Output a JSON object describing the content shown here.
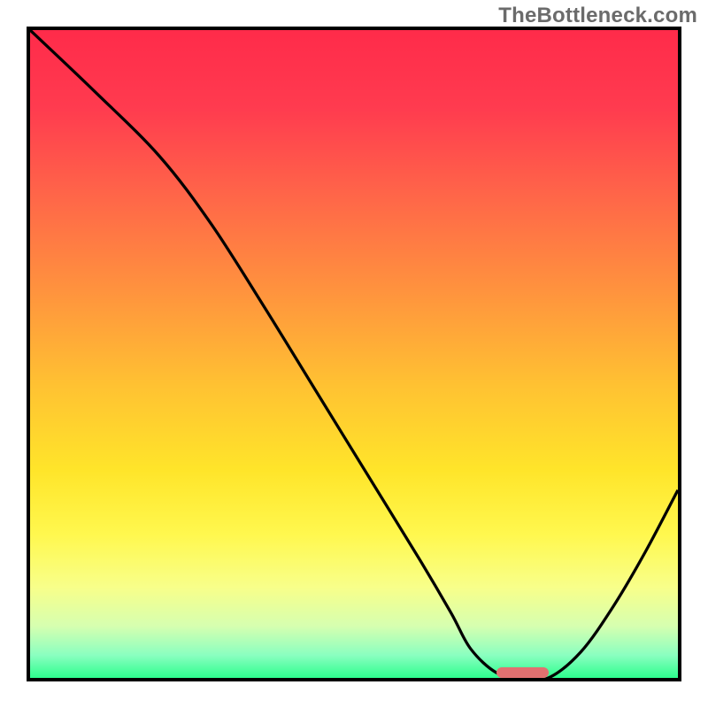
{
  "watermark": "TheBottleneck.com",
  "gradient_stops": [
    {
      "offset": 0.0,
      "color": "#ff2b4a"
    },
    {
      "offset": 0.12,
      "color": "#ff3b4f"
    },
    {
      "offset": 0.25,
      "color": "#ff6449"
    },
    {
      "offset": 0.4,
      "color": "#ff923e"
    },
    {
      "offset": 0.55,
      "color": "#ffc232"
    },
    {
      "offset": 0.68,
      "color": "#ffe52a"
    },
    {
      "offset": 0.78,
      "color": "#fff84f"
    },
    {
      "offset": 0.86,
      "color": "#f8ff8a"
    },
    {
      "offset": 0.92,
      "color": "#d6ffb0"
    },
    {
      "offset": 0.965,
      "color": "#8affc0"
    },
    {
      "offset": 1.0,
      "color": "#2dfd8e"
    }
  ],
  "chart_data": {
    "type": "line",
    "title": "",
    "xlabel": "",
    "ylabel": "",
    "xlim": [
      0,
      1
    ],
    "ylim": [
      0,
      1
    ],
    "x": [
      0.0,
      0.1,
      0.2,
      0.28,
      0.36,
      0.44,
      0.52,
      0.6,
      0.65,
      0.68,
      0.72,
      0.76,
      0.8,
      0.85,
      0.9,
      0.95,
      1.0
    ],
    "values": [
      1.0,
      0.905,
      0.805,
      0.7,
      0.575,
      0.445,
      0.315,
      0.185,
      0.1,
      0.045,
      0.008,
      0.0,
      0.0,
      0.04,
      0.11,
      0.195,
      0.29
    ],
    "optimal_range_x": [
      0.72,
      0.8
    ],
    "annotations": [],
    "legend": []
  }
}
